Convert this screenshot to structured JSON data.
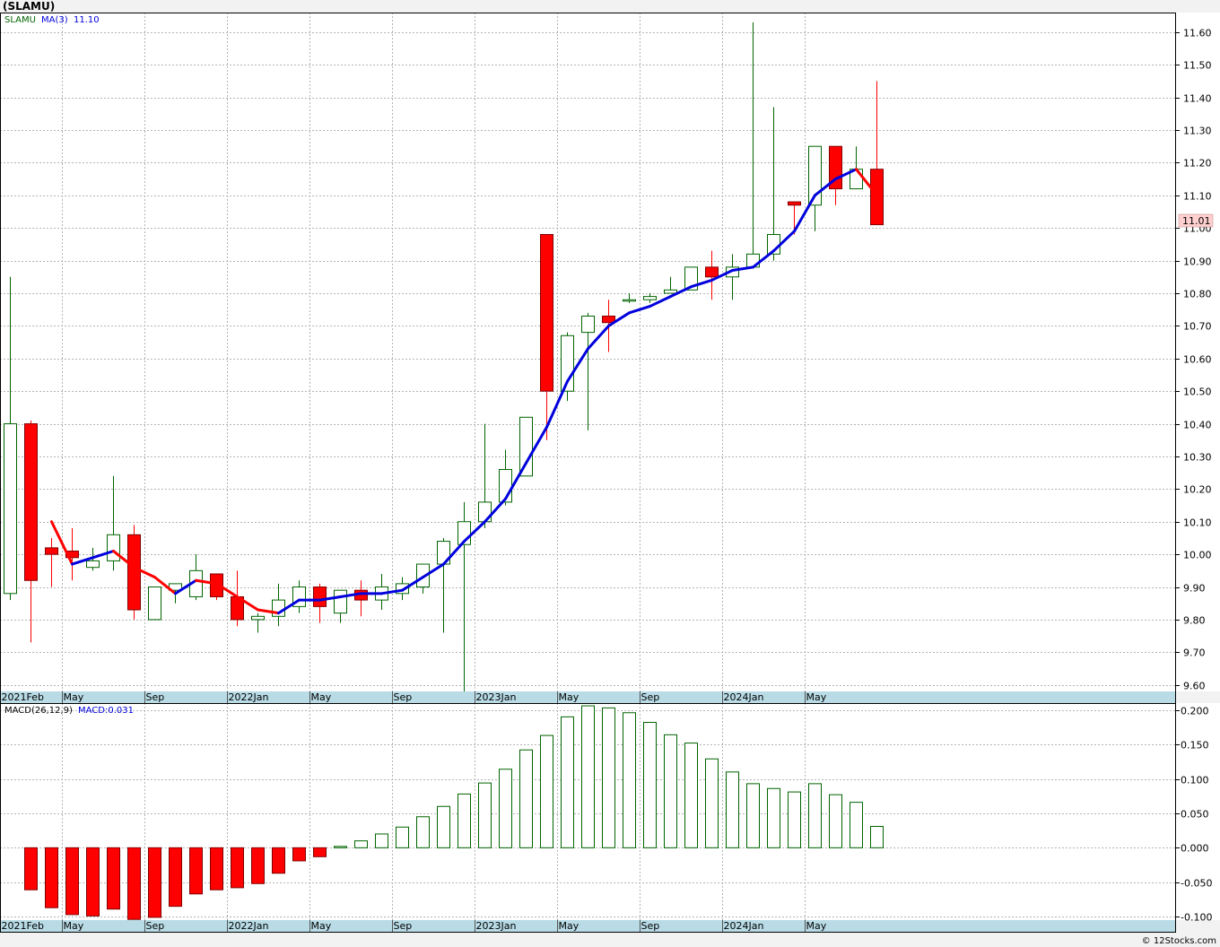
{
  "title": "(SLAMU)",
  "footer": "© 12Stocks.com",
  "colors": {
    "up": "#006400",
    "down": "#ff0000",
    "ma_up": "#0000dd",
    "ma_down": "#ff0000",
    "macd": "#006400",
    "axis_band": "#b8dbe6",
    "last_price_bg": "#ffd0d0"
  },
  "legend": {
    "price_symbol": "SLAMU",
    "ma_label": "MA(3)",
    "ma_value": "11.10",
    "macd_label": "MACD(26,12,9)",
    "macd_value": "MACD:0.031"
  },
  "last_price_label": "11.01",
  "x_labels": [
    "2021Feb",
    "May",
    "Sep",
    "2022Jan",
    "May",
    "Sep",
    "2023Jan",
    "May",
    "Sep",
    "2024Jan",
    "May"
  ],
  "x_label_months": [
    0,
    3,
    7,
    11,
    15,
    19,
    23,
    27,
    31,
    35,
    39
  ],
  "chart_data": [
    {
      "type": "candlestick",
      "title": "(SLAMU)",
      "ylim": [
        9.58,
        11.66
      ],
      "y_ticks": [
        "9.60",
        "9.70",
        "9.80",
        "9.90",
        "10.00",
        "10.10",
        "10.20",
        "10.30",
        "10.40",
        "10.50",
        "10.60",
        "10.70",
        "10.80",
        "10.90",
        "11.00",
        "11.10",
        "11.20",
        "11.30",
        "11.40",
        "11.50",
        "11.60"
      ],
      "candles": [
        {
          "o": 9.88,
          "h": 10.85,
          "l": 9.86,
          "c": 10.4
        },
        {
          "o": 10.4,
          "h": 10.41,
          "l": 9.73,
          "c": 9.92
        },
        {
          "o": 10.02,
          "h": 10.05,
          "l": 9.9,
          "c": 10.0
        },
        {
          "o": 10.01,
          "h": 10.08,
          "l": 9.92,
          "c": 9.99
        },
        {
          "o": 9.96,
          "h": 10.02,
          "l": 9.95,
          "c": 9.98
        },
        {
          "o": 9.98,
          "h": 10.24,
          "l": 9.95,
          "c": 10.06
        },
        {
          "o": 10.06,
          "h": 10.09,
          "l": 9.8,
          "c": 9.83
        },
        {
          "o": 9.8,
          "h": 9.9,
          "l": 9.8,
          "c": 9.9
        },
        {
          "o": 9.89,
          "h": 9.91,
          "l": 9.85,
          "c": 9.91
        },
        {
          "o": 9.87,
          "h": 10.0,
          "l": 9.86,
          "c": 9.95
        },
        {
          "o": 9.94,
          "h": 9.94,
          "l": 9.86,
          "c": 9.87
        },
        {
          "o": 9.87,
          "h": 9.95,
          "l": 9.78,
          "c": 9.8
        },
        {
          "o": 9.8,
          "h": 9.82,
          "l": 9.76,
          "c": 9.81
        },
        {
          "o": 9.81,
          "h": 9.91,
          "l": 9.78,
          "c": 9.86
        },
        {
          "o": 9.84,
          "h": 9.92,
          "l": 9.82,
          "c": 9.9
        },
        {
          "o": 9.9,
          "h": 9.91,
          "l": 9.79,
          "c": 9.84
        },
        {
          "o": 9.82,
          "h": 9.89,
          "l": 9.79,
          "c": 9.89
        },
        {
          "o": 9.89,
          "h": 9.92,
          "l": 9.81,
          "c": 9.86
        },
        {
          "o": 9.86,
          "h": 9.94,
          "l": 9.83,
          "c": 9.9
        },
        {
          "o": 9.88,
          "h": 9.93,
          "l": 9.86,
          "c": 9.91
        },
        {
          "o": 9.9,
          "h": 9.97,
          "l": 9.88,
          "c": 9.97
        },
        {
          "o": 9.97,
          "h": 10.05,
          "l": 9.76,
          "c": 10.04
        },
        {
          "o": 10.03,
          "h": 10.16,
          "l": 9.58,
          "c": 10.1
        },
        {
          "o": 10.1,
          "h": 10.4,
          "l": 10.08,
          "c": 10.16
        },
        {
          "o": 10.16,
          "h": 10.32,
          "l": 10.15,
          "c": 10.26
        },
        {
          "o": 10.24,
          "h": 10.42,
          "l": 10.24,
          "c": 10.42
        },
        {
          "o": 10.98,
          "h": 10.98,
          "l": 10.35,
          "c": 10.5
        },
        {
          "o": 10.5,
          "h": 10.68,
          "l": 10.47,
          "c": 10.67
        },
        {
          "o": 10.68,
          "h": 10.74,
          "l": 10.38,
          "c": 10.73
        },
        {
          "o": 10.73,
          "h": 10.78,
          "l": 10.62,
          "c": 10.71
        },
        {
          "o": 10.78,
          "h": 10.8,
          "l": 10.77,
          "c": 10.78
        },
        {
          "o": 10.78,
          "h": 10.8,
          "l": 10.77,
          "c": 10.79
        },
        {
          "o": 10.8,
          "h": 10.85,
          "l": 10.8,
          "c": 10.81
        },
        {
          "o": 10.81,
          "h": 10.88,
          "l": 10.81,
          "c": 10.88
        },
        {
          "o": 10.88,
          "h": 10.93,
          "l": 10.78,
          "c": 10.85
        },
        {
          "o": 10.85,
          "h": 10.92,
          "l": 10.78,
          "c": 10.88
        },
        {
          "o": 10.88,
          "h": 11.63,
          "l": 10.88,
          "c": 10.92
        },
        {
          "o": 10.92,
          "h": 11.37,
          "l": 10.9,
          "c": 10.98
        },
        {
          "o": 11.08,
          "h": 11.08,
          "l": 10.98,
          "c": 11.07
        },
        {
          "o": 11.07,
          "h": 11.25,
          "l": 10.99,
          "c": 11.25
        },
        {
          "o": 11.25,
          "h": 11.25,
          "l": 11.07,
          "c": 11.12
        },
        {
          "o": 11.12,
          "h": 11.25,
          "l": 11.12,
          "c": 11.18
        },
        {
          "o": 11.18,
          "h": 11.45,
          "l": 11.01,
          "c": 11.01
        }
      ],
      "ma3": [
        null,
        null,
        10.1,
        9.97,
        9.99,
        10.01,
        9.96,
        9.93,
        9.88,
        9.92,
        9.91,
        9.87,
        9.83,
        9.82,
        9.86,
        9.86,
        9.87,
        9.88,
        9.88,
        9.89,
        9.93,
        9.97,
        10.04,
        10.1,
        10.17,
        10.28,
        10.39,
        10.53,
        10.63,
        10.7,
        10.74,
        10.76,
        10.79,
        10.82,
        10.84,
        10.87,
        10.88,
        10.93,
        10.99,
        11.1,
        11.15,
        11.18,
        11.1
      ]
    },
    {
      "type": "bar",
      "title": "MACD(26,12,9)",
      "ylim": [
        -0.105,
        0.21
      ],
      "y_ticks": [
        "-0.100",
        "-0.050",
        "0.000",
        "0.050",
        "0.100",
        "0.150",
        "0.200"
      ],
      "values": [
        null,
        -0.061,
        -0.087,
        -0.097,
        -0.099,
        -0.089,
        -0.104,
        -0.101,
        -0.085,
        -0.067,
        -0.061,
        -0.058,
        -0.052,
        -0.037,
        -0.019,
        -0.013,
        0.002,
        0.01,
        0.02,
        0.03,
        0.045,
        0.06,
        0.078,
        0.094,
        0.114,
        0.142,
        0.163,
        0.19,
        0.206,
        0.203,
        0.196,
        0.182,
        0.164,
        0.152,
        0.129,
        0.11,
        0.093,
        0.086,
        0.081,
        0.093,
        0.077,
        0.066,
        0.031
      ]
    }
  ]
}
